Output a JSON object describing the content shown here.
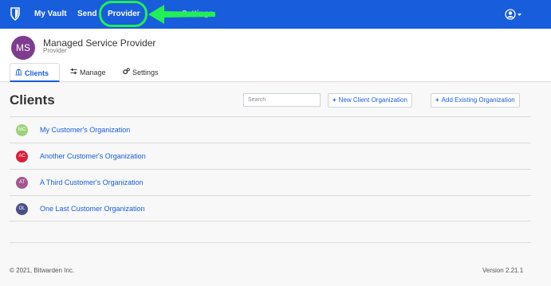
{
  "topnav": {
    "items": [
      {
        "label": "My Vault"
      },
      {
        "label": "Send"
      },
      {
        "label": "Provider"
      },
      {
        "label": "Settings"
      }
    ],
    "bg_color": "#175ddc",
    "highlight_color": "#22ee55",
    "profile_icon": "user-circle-icon"
  },
  "header": {
    "avatar_initials": "MS",
    "avatar_color": "#7e3c8e",
    "org_name": "Managed Service Provider",
    "org_type": "Provider",
    "tabs": [
      {
        "label": "Clients",
        "icon": "bank-icon",
        "active": true
      },
      {
        "label": "Manage",
        "icon": "sliders-icon",
        "active": false
      },
      {
        "label": "Settings",
        "icon": "cogs-icon",
        "active": false
      }
    ]
  },
  "main": {
    "title": "Clients",
    "search_placeholder": "Search",
    "new_org_button": "New Client Organization",
    "add_existing_button": "Add Existing Organization",
    "clients": [
      {
        "initials": "MC",
        "name": "My Customer's Organization",
        "color": "#9ed27a"
      },
      {
        "initials": "AC",
        "name": "Another Customer's Organization",
        "color": "#d91f3c"
      },
      {
        "initials": "AT",
        "name": "A Third Customer's Organization",
        "color": "#a4578e"
      },
      {
        "initials": "OL",
        "name": "One Last Customer Organization",
        "color": "#4a4f8a"
      }
    ]
  },
  "footer": {
    "copyright": "© 2021, Bitwarden Inc.",
    "version": "Version 2.21.1"
  }
}
